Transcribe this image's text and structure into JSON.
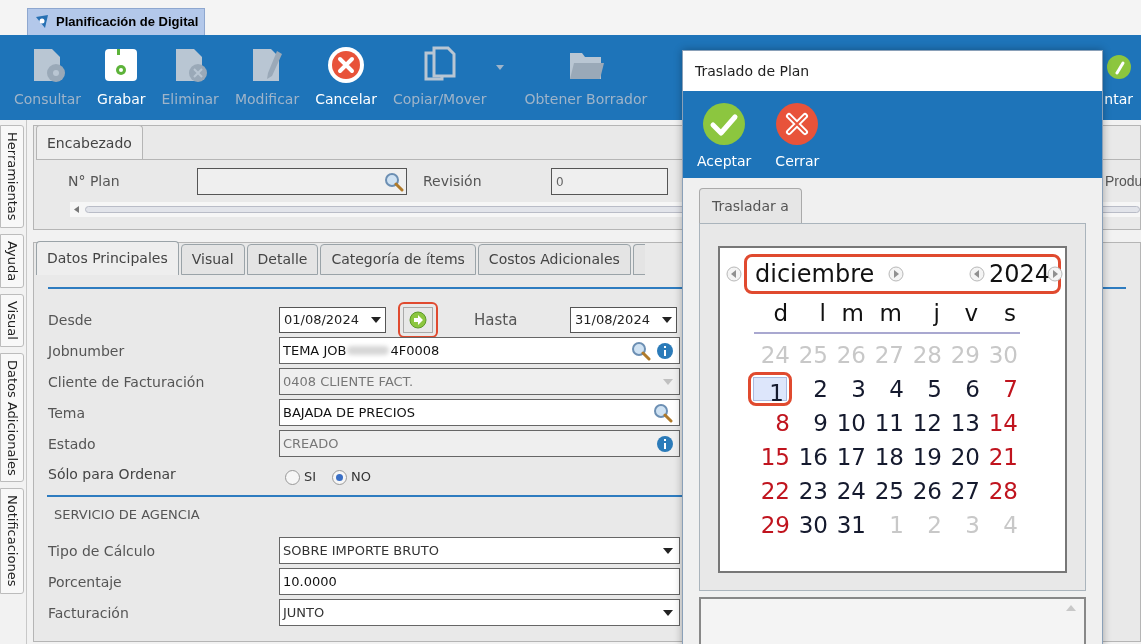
{
  "app_tab": {
    "title": "Planificación de Digital"
  },
  "toolbar": {
    "items": [
      {
        "label": "Consultar",
        "kind": "query",
        "disabled": true
      },
      {
        "label": "Grabar",
        "kind": "save",
        "disabled": false
      },
      {
        "label": "Eliminar",
        "kind": "delete",
        "disabled": true
      },
      {
        "label": "Modificar",
        "kind": "edit",
        "disabled": true
      },
      {
        "label": "Cancelar",
        "kind": "cancel",
        "disabled": false
      },
      {
        "label": "Copiar/Mover",
        "kind": "copy",
        "disabled": true
      },
      {
        "label": "Obtener Borrador",
        "kind": "folder",
        "disabled": true
      }
    ],
    "right_item": {
      "label": "ntar",
      "kind": "attach",
      "disabled": false
    }
  },
  "side_tabs": [
    "Herramientas",
    "Ayuda",
    "Visual",
    "Datos Adicionales",
    "Notificaciones"
  ],
  "header": {
    "tab": "Encabezado",
    "plan_label": "N° Plan",
    "revision_label": "Revisión",
    "revision_value": "0",
    "cut_label": "Produ"
  },
  "tabs": [
    {
      "label": "Datos Principales",
      "selected": true
    },
    {
      "label": "Visual",
      "selected": false
    },
    {
      "label": "Detalle",
      "selected": false
    },
    {
      "label": "Categoría de ítems",
      "selected": false
    },
    {
      "label": "Costos Adicionales",
      "selected": false
    }
  ],
  "form": [
    {
      "kind": "daterange",
      "label": "Desde",
      "value": "01/08/2024",
      "to_label": "Hasta",
      "to_value": "31/08/2024",
      "highlighted": true
    },
    {
      "kind": "field",
      "label": "Jobnumber",
      "value_start": "TEMA JOB",
      "value_end": "4F0008",
      "search": true,
      "info": true,
      "disabled": false
    },
    {
      "kind": "select",
      "label": "Cliente de Facturación",
      "value": "0408 CLIENTE FACT.",
      "disabled": true
    },
    {
      "kind": "field",
      "label": "Tema",
      "value_start": "BAJADA DE PRECIOS",
      "search": true,
      "disabled": false
    },
    {
      "kind": "field",
      "label": "Estado",
      "value_start": "CREADO",
      "info": true,
      "disabled": true
    },
    {
      "kind": "radio",
      "label": "Sólo para Ordenar",
      "options": [
        {
          "label": "SI",
          "selected": false
        },
        {
          "label": "NO",
          "selected": true
        }
      ]
    },
    {
      "kind": "section",
      "label": "SERVICIO DE AGENCIA"
    },
    {
      "kind": "select",
      "label": "Tipo de Cálculo",
      "value": "SOBRE IMPORTE BRUTO",
      "disabled": false
    },
    {
      "kind": "field",
      "label": "Porcentaje",
      "value_start": "10.0000",
      "disabled": false
    },
    {
      "kind": "select",
      "label": "Facturación",
      "value": "JUNTO",
      "disabled": false
    }
  ],
  "dialog": {
    "title": "Traslado de Plan",
    "buttons": [
      {
        "label": "Aceptar",
        "kind": "accept"
      },
      {
        "label": "Cerrar",
        "kind": "close"
      }
    ],
    "tab": "Trasladar a",
    "calendar": {
      "month": "diciembre",
      "year": "2024",
      "highlighted": true,
      "weekdays": [
        "d",
        "l",
        "m",
        "m",
        "j",
        "v",
        "s"
      ],
      "days": [
        {
          "label": "24",
          "kind": "other",
          "selected": false
        },
        {
          "label": "25",
          "kind": "other",
          "selected": false
        },
        {
          "label": "26",
          "kind": "other",
          "selected": false
        },
        {
          "label": "27",
          "kind": "other",
          "selected": false
        },
        {
          "label": "28",
          "kind": "other",
          "selected": false
        },
        {
          "label": "29",
          "kind": "other",
          "selected": false
        },
        {
          "label": "30",
          "kind": "other",
          "selected": false
        },
        {
          "label": "1",
          "kind": "weekday",
          "selected": true
        },
        {
          "label": "2",
          "kind": "weekday",
          "selected": false
        },
        {
          "label": "3",
          "kind": "weekday",
          "selected": false
        },
        {
          "label": "4",
          "kind": "weekday",
          "selected": false
        },
        {
          "label": "5",
          "kind": "weekday",
          "selected": false
        },
        {
          "label": "6",
          "kind": "weekday",
          "selected": false
        },
        {
          "label": "7",
          "kind": "weekend",
          "selected": false
        },
        {
          "label": "8",
          "kind": "weekend",
          "selected": false
        },
        {
          "label": "9",
          "kind": "weekday",
          "selected": false
        },
        {
          "label": "10",
          "kind": "weekday",
          "selected": false
        },
        {
          "label": "11",
          "kind": "weekday",
          "selected": false
        },
        {
          "label": "12",
          "kind": "weekday",
          "selected": false
        },
        {
          "label": "13",
          "kind": "weekday",
          "selected": false
        },
        {
          "label": "14",
          "kind": "weekend",
          "selected": false
        },
        {
          "label": "15",
          "kind": "weekend",
          "selected": false
        },
        {
          "label": "16",
          "kind": "weekday",
          "selected": false
        },
        {
          "label": "17",
          "kind": "weekday",
          "selected": false
        },
        {
          "label": "18",
          "kind": "weekday",
          "selected": false
        },
        {
          "label": "19",
          "kind": "weekday",
          "selected": false
        },
        {
          "label": "20",
          "kind": "weekday",
          "selected": false
        },
        {
          "label": "21",
          "kind": "weekend",
          "selected": false
        },
        {
          "label": "22",
          "kind": "weekend",
          "selected": false
        },
        {
          "label": "23",
          "kind": "weekday",
          "selected": false
        },
        {
          "label": "24",
          "kind": "weekday",
          "selected": false
        },
        {
          "label": "25",
          "kind": "weekday",
          "selected": false
        },
        {
          "label": "26",
          "kind": "weekday",
          "selected": false
        },
        {
          "label": "27",
          "kind": "weekday",
          "selected": false
        },
        {
          "label": "28",
          "kind": "weekend",
          "selected": false
        },
        {
          "label": "29",
          "kind": "weekend",
          "selected": false
        },
        {
          "label": "30",
          "kind": "weekday",
          "selected": false
        },
        {
          "label": "31",
          "kind": "weekday",
          "selected": false
        },
        {
          "label": "1",
          "kind": "other",
          "selected": false
        },
        {
          "label": "2",
          "kind": "other",
          "selected": false
        },
        {
          "label": "3",
          "kind": "other",
          "selected": false
        },
        {
          "label": "4",
          "kind": "other",
          "selected": false
        }
      ]
    }
  }
}
